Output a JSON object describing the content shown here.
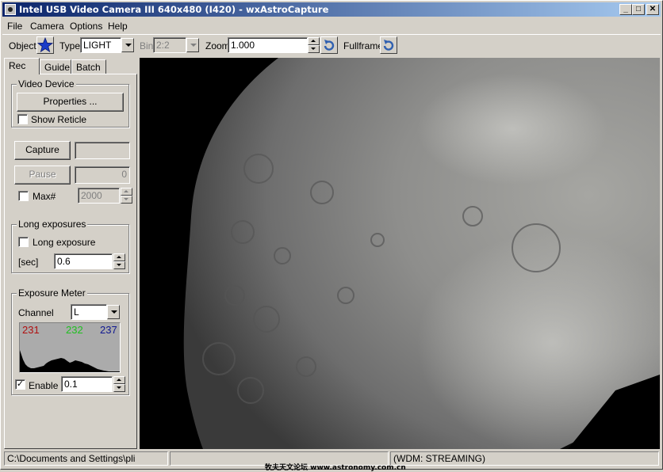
{
  "window": {
    "title": "Intel USB Video Camera III 640x480 (I420) - wxAstroCapture",
    "controls": {
      "minimize": "_",
      "maximize": "□",
      "close": "✕"
    }
  },
  "menu": [
    "File",
    "Camera",
    "Options",
    "Help"
  ],
  "toolbar": {
    "object_label": "Object",
    "object_icon": "star-icon",
    "type_label": "Type",
    "type_value": "LIGHT",
    "bin_label": "Bin",
    "bin_value": "2:2",
    "zoom_label": "Zoom",
    "zoom_value": "1.000",
    "zoom_reset_icon": "rotate-icon",
    "fullframe_label": "Fullframe",
    "fullframe_icon": "rotate-icon"
  },
  "tabs": [
    "Rec",
    "Guide",
    "Batch"
  ],
  "rec": {
    "video_device": {
      "title": "Video Device",
      "properties_button": "Properties ...",
      "show_reticle_label": "Show Reticle",
      "show_reticle_checked": false
    },
    "capture_button": "Capture",
    "capture_value": "",
    "pause_button": "Pause",
    "pause_value": "0",
    "max_label": "Max#",
    "max_checked": false,
    "max_value": "2000",
    "long_exposures": {
      "title": "Long exposures",
      "long_exposure_label": "Long exposure",
      "long_exposure_checked": false,
      "sec_label": "[sec]",
      "sec_value": "0.6"
    },
    "exposure_meter": {
      "title": "Exposure Meter",
      "channel_label": "Channel",
      "channel_value": "L",
      "red_value": "231",
      "green_value": "232",
      "blue_value": "237",
      "enable_label": "Enable",
      "enable_checked": true,
      "enable_value": "0.1"
    }
  },
  "status": {
    "path": "C:\\Documents and Settings\\pli",
    "middle": "",
    "stream": "(WDM: STREAMING)",
    "watermark": "牧夫天文论坛 www.astronomy.com.cn"
  },
  "colors": {
    "red": "#b01010",
    "green": "#20c020",
    "blue": "#101890"
  }
}
